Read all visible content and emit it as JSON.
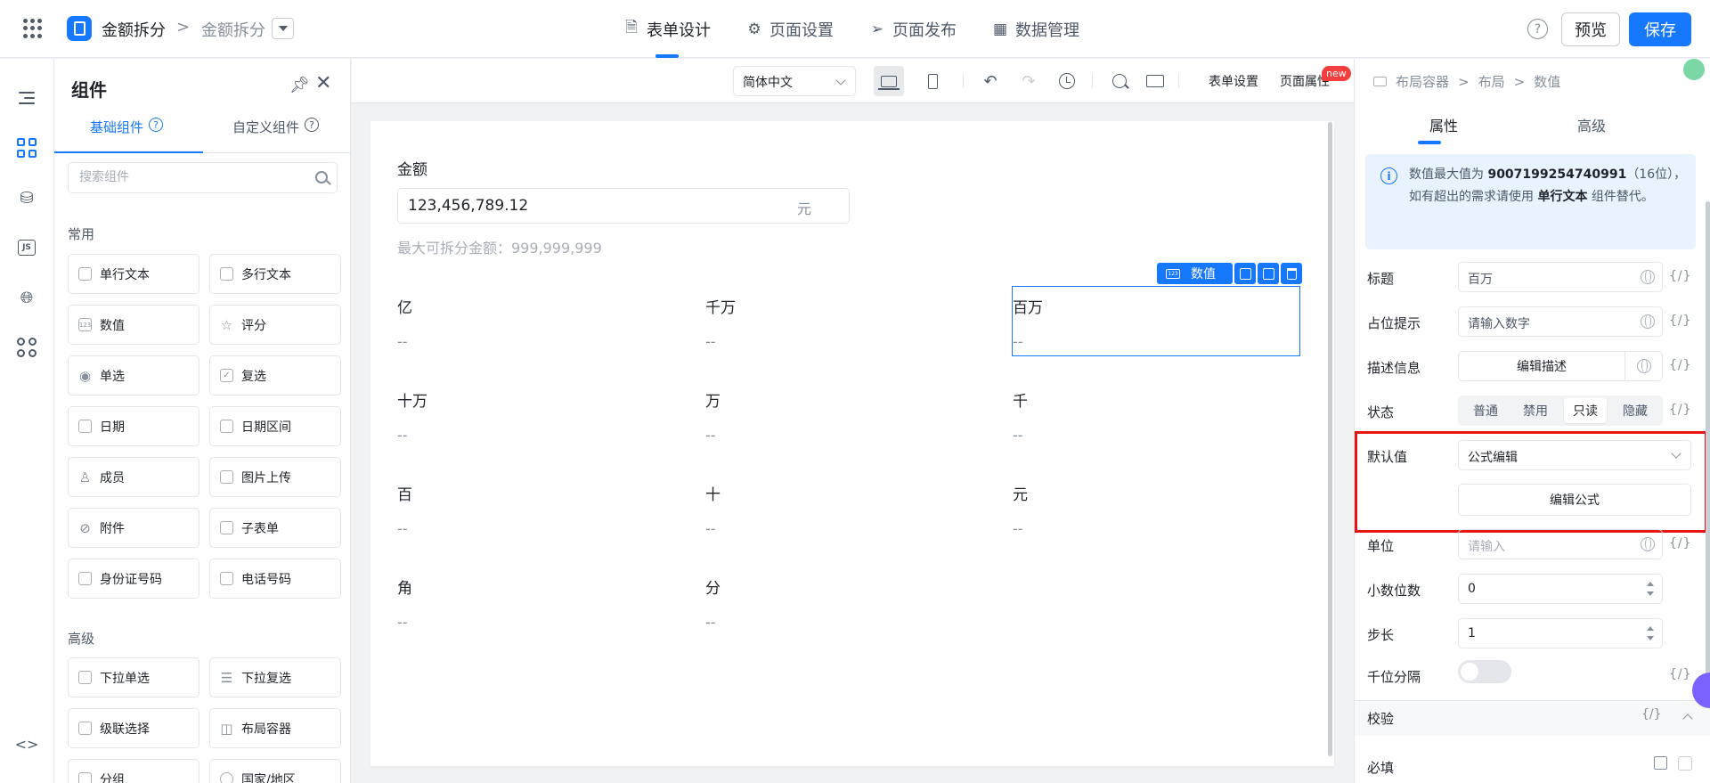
{
  "header": {
    "app_name": "金额拆分",
    "breadcrumb_sep": ">",
    "page_name": "金额拆分",
    "nav": [
      {
        "icon": "document-icon",
        "label": "表单设计",
        "active": true
      },
      {
        "icon": "gear-icon",
        "label": "页面设置",
        "active": false
      },
      {
        "icon": "send-icon",
        "label": "页面发布",
        "active": false
      },
      {
        "icon": "table-icon",
        "label": "数据管理",
        "active": false
      }
    ],
    "help": "?",
    "preview": "预览",
    "save": "保存"
  },
  "components_panel": {
    "title": "组件",
    "tabs": [
      "基础组件",
      "自定义组件"
    ],
    "search_placeholder": "搜索组件",
    "sections": [
      {
        "title": "常用",
        "items": [
          {
            "label": "单行文本",
            "icon": "text-input-icon"
          },
          {
            "label": "多行文本",
            "icon": "textarea-icon"
          },
          {
            "label": "数值",
            "icon": "number-icon"
          },
          {
            "label": "评分",
            "icon": "star-icon"
          },
          {
            "label": "单选",
            "icon": "radio-icon"
          },
          {
            "label": "复选",
            "icon": "checkbox-icon"
          },
          {
            "label": "日期",
            "icon": "calendar-icon"
          },
          {
            "label": "日期区间",
            "icon": "date-range-icon"
          },
          {
            "label": "成员",
            "icon": "user-icon"
          },
          {
            "label": "图片上传",
            "icon": "image-icon"
          },
          {
            "label": "附件",
            "icon": "paperclip-icon"
          },
          {
            "label": "子表单",
            "icon": "subform-icon"
          },
          {
            "label": "身份证号码",
            "icon": "id-card-icon"
          },
          {
            "label": "电话号码",
            "icon": "phone-icon"
          }
        ]
      },
      {
        "title": "高级",
        "items": [
          {
            "label": "下拉单选",
            "icon": "select-icon"
          },
          {
            "label": "下拉复选",
            "icon": "multi-select-icon"
          },
          {
            "label": "级联选择",
            "icon": "cascade-icon"
          },
          {
            "label": "布局容器",
            "icon": "layout-icon"
          },
          {
            "label": "分组",
            "icon": "group-icon"
          },
          {
            "label": "国家/地区",
            "icon": "globe-icon"
          }
        ]
      }
    ]
  },
  "toolbar": {
    "language": "简体中文",
    "form_settings": "表单设置",
    "page_props": "页面属性",
    "new_badge": "new"
  },
  "form": {
    "amount_label": "金额",
    "amount_value": "123,456,789.12",
    "amount_unit": "元",
    "hint": "最大可拆分金额：999,999,999",
    "selected_tag": "数值",
    "cells": [
      {
        "label": "亿",
        "value": "--"
      },
      {
        "label": "千万",
        "value": "--"
      },
      {
        "label": "百万",
        "value": "--"
      },
      {
        "label": "十万",
        "value": "--"
      },
      {
        "label": "万",
        "value": "--"
      },
      {
        "label": "千",
        "value": "--"
      },
      {
        "label": "百",
        "value": "--"
      },
      {
        "label": "十",
        "value": "--"
      },
      {
        "label": "元",
        "value": "--"
      },
      {
        "label": "角",
        "value": "--"
      },
      {
        "label": "分",
        "value": "--"
      }
    ]
  },
  "props": {
    "breadcrumb": [
      "布局容器",
      "布局",
      "数值"
    ],
    "tabs": [
      "属性",
      "高级"
    ],
    "info": {
      "prefix": "数值最大值为 ",
      "max": "9007199254740991",
      "middle": "（16位），如有超出的需求请使用 ",
      "alt": "单行文本",
      "suffix": " 组件替代。"
    },
    "fields": {
      "title_label": "标题",
      "title_value": "百万",
      "placeholder_label": "占位提示",
      "placeholder_value": "请输入数字",
      "desc_label": "描述信息",
      "desc_button": "编辑描述",
      "status_label": "状态",
      "status_options": [
        "普通",
        "禁用",
        "只读",
        "隐藏"
      ],
      "status_selected": "只读",
      "default_label": "默认值",
      "default_value": "公式编辑",
      "formula_button": "编辑公式",
      "unit_label": "单位",
      "unit_placeholder": "请输入",
      "decimals_label": "小数位数",
      "decimals_value": "0",
      "step_label": "步长",
      "step_value": "1",
      "thousands_label": "千位分隔",
      "thousands_on": false,
      "fx": "{/}"
    },
    "validation": {
      "title": "校验",
      "required_label": "必填"
    }
  }
}
